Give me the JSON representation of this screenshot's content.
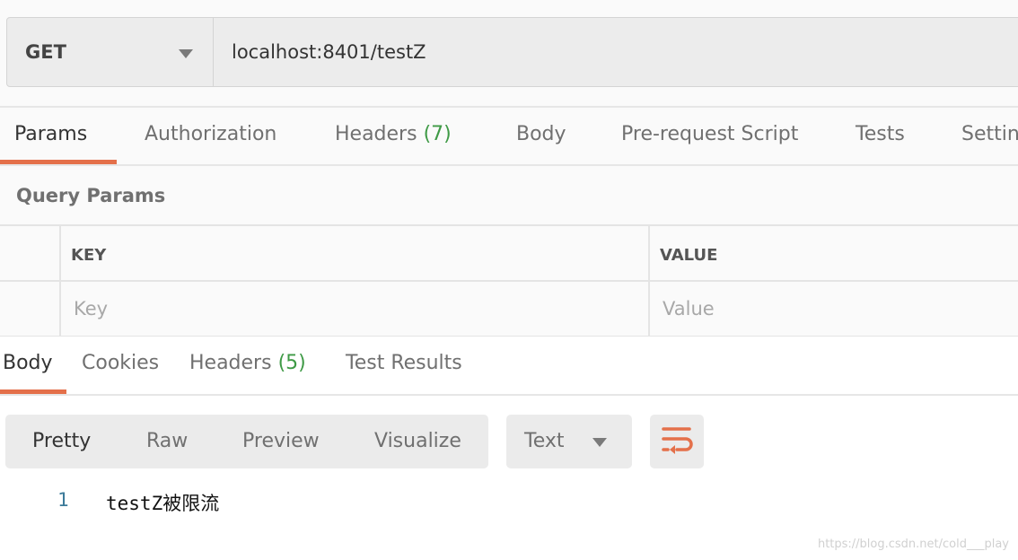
{
  "request": {
    "method": "GET",
    "url": "localhost:8401/testZ"
  },
  "request_tabs": [
    {
      "label": "Params"
    },
    {
      "label": "Authorization"
    },
    {
      "label": "Headers",
      "count": "(7)"
    },
    {
      "label": "Body"
    },
    {
      "label": "Pre-request Script"
    },
    {
      "label": "Tests"
    },
    {
      "label": "Settin"
    }
  ],
  "query_params": {
    "title": "Query Params",
    "columns": [
      "KEY",
      "VALUE"
    ],
    "placeholders": {
      "key": "Key",
      "value": "Value"
    }
  },
  "response_tabs": [
    {
      "label": "Body"
    },
    {
      "label": "Cookies"
    },
    {
      "label": "Headers",
      "count": "(5)"
    },
    {
      "label": "Test Results"
    }
  ],
  "view_modes": [
    "Pretty",
    "Raw",
    "Preview",
    "Visualize"
  ],
  "format": "Text",
  "response_body": [
    {
      "line": "1",
      "text": "testZ被限流"
    }
  ],
  "watermark": "https://blog.csdn.net/cold___play",
  "colors": {
    "accent": "#e4704a",
    "count": "#3f9a46",
    "line_number": "#3b7a99"
  }
}
